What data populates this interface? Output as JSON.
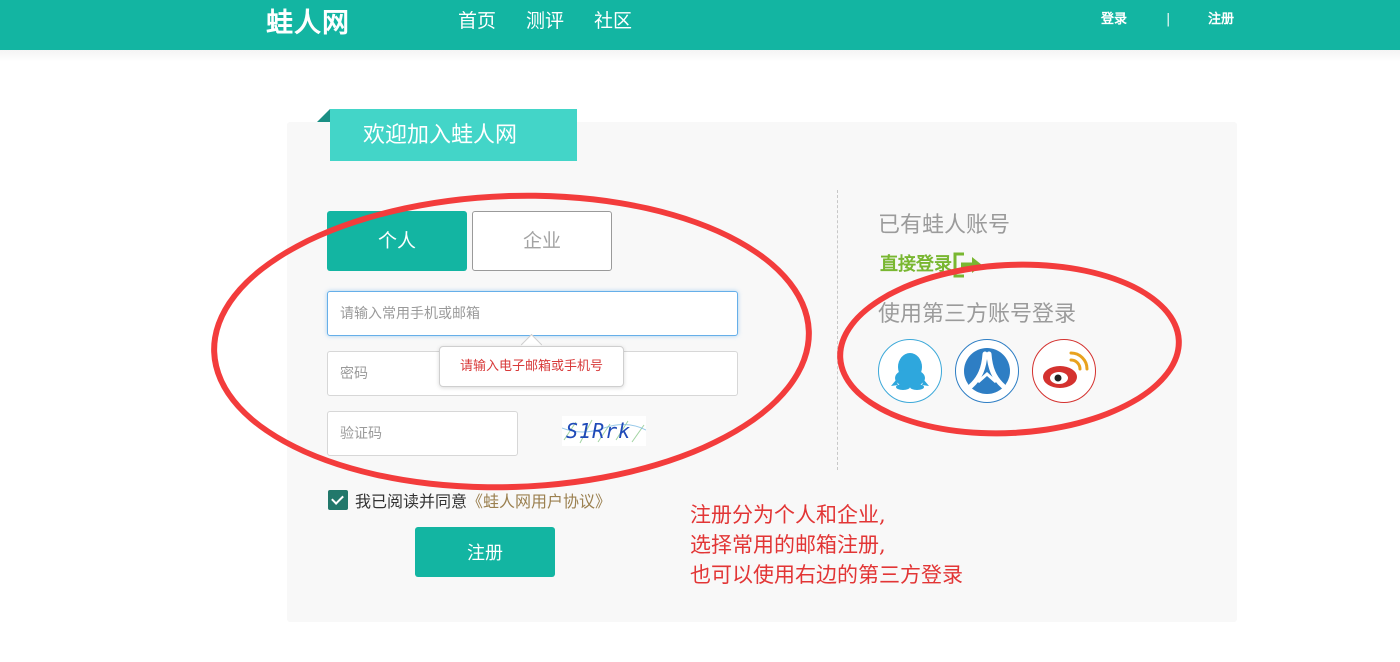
{
  "header": {
    "logo": "蛙人网",
    "nav": [
      "首页",
      "测评",
      "社区"
    ],
    "login_label": "登录",
    "separator": "|",
    "register_label": "注册"
  },
  "form": {
    "title": "欢迎加入蛙人网",
    "tabs": [
      "个人",
      "企业"
    ],
    "active_tab": "个人",
    "account_placeholder": "请输入常用手机或邮箱",
    "account_tooltip": "请输入电子邮箱或手机号",
    "password_placeholder": "密码",
    "captcha_placeholder": "验证码",
    "captcha_text": "S1Rrk",
    "agree_text": "我已阅读并同意",
    "agree_link": "《蛙人网用户协议》",
    "agree_checked": true,
    "submit_label": "注册"
  },
  "side": {
    "have_account": "已有蛙人账号",
    "direct_login": "直接登录",
    "third_party_title": "使用第三方账号登录",
    "providers": [
      "qq-icon",
      "renren-icon",
      "weibo-icon"
    ]
  },
  "annotation": {
    "lines": [
      "注册分为个人和企业,",
      "选择常用的邮箱注册,",
      "也可以使用右边的第三方登录"
    ],
    "color": "#e23535"
  },
  "colors": {
    "brand": "#13b5a2",
    "ribbon": "#43d5c8",
    "login_green": "#79b731"
  }
}
